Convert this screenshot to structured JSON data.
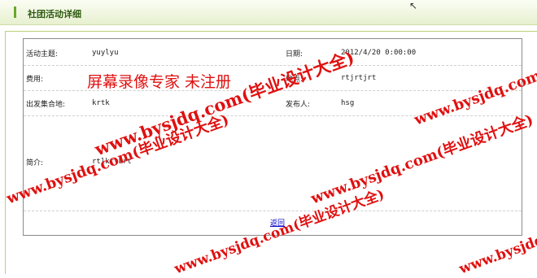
{
  "header": {
    "title": "社团活动详细"
  },
  "fields": {
    "topic": {
      "label": "活动主题:",
      "value": "yuylyu"
    },
    "date": {
      "label": "日期:",
      "value": "2012/4/20 0:00:00"
    },
    "fee": {
      "label": "费用:",
      "value": ""
    },
    "place": {
      "label": "地点:",
      "value": "rtjrtjrt"
    },
    "gather": {
      "label": "出发集合地:",
      "value": "krtk"
    },
    "publisher": {
      "label": "发布人:",
      "value": "hsg"
    },
    "intro": {
      "label": "简介:",
      "value": "rtlkrtkrt"
    }
  },
  "actions": {
    "back_label": "返回"
  },
  "watermarks": {
    "recorder": "屏幕录像专家  未注册",
    "site": "www.bysjdq.com(毕业设计大全)",
    "colors": {
      "watermark": "#e01010"
    }
  }
}
